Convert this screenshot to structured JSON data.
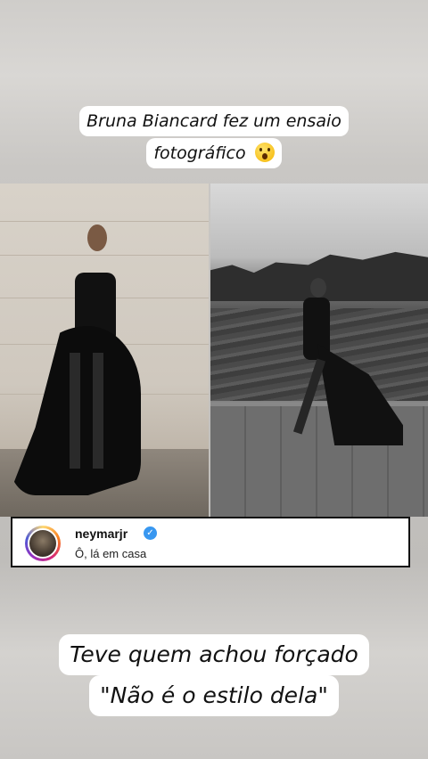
{
  "top_caption": {
    "line1": "Bruna Biancard fez um ensaio",
    "line2": "fotográfico",
    "emoji": "astonished-face-emoji"
  },
  "photos": {
    "left": "studio-photo",
    "right": "riverside-photo"
  },
  "comment": {
    "username": "neymarjr",
    "verified_icon": "verified-badge-icon",
    "text": "Ô, lá em casa",
    "ring_colors": [
      "#feda75",
      "#fa7e1e",
      "#d62976",
      "#962fbf",
      "#4f5bd5"
    ],
    "verified_color": "#3897f0"
  },
  "bottom_caption": {
    "line1": "Teve quem achou forçado",
    "line2": "\"Não é o estilo dela\""
  }
}
